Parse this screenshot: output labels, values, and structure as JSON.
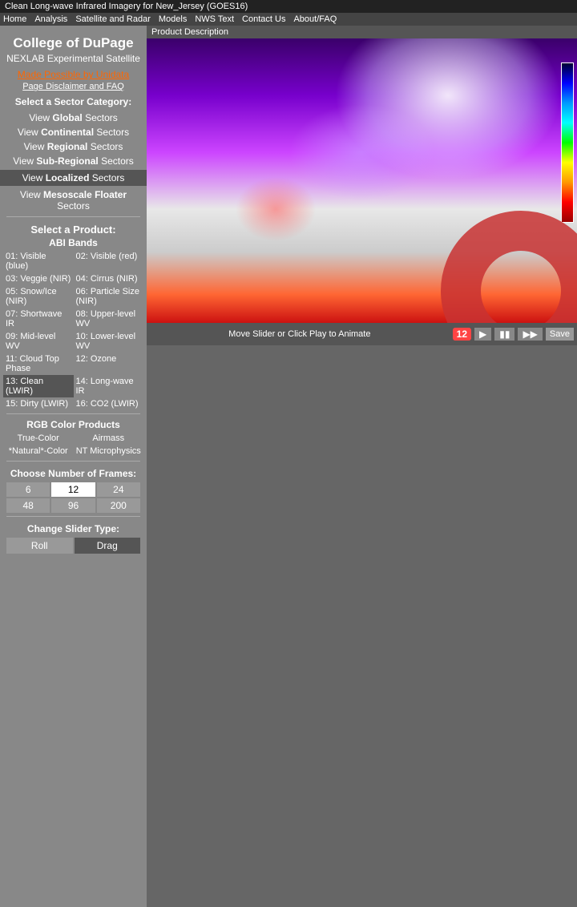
{
  "title_bar": {
    "text": "Clean Long-wave Infrared Imagery for New_Jersey (GOES16)"
  },
  "nav": {
    "items": [
      "Home",
      "Analysis",
      "Satellite and Radar",
      "Models",
      "NWS Text",
      "Contact Us",
      "About/FAQ"
    ]
  },
  "sidebar": {
    "college_name": "College of DuPage",
    "nexlab": "NEXLAB Experimental Satellite",
    "unidata_link": "Made Possible by Unidata",
    "disclaimer_link": "Page Disclaimer and FAQ",
    "sector_category_label": "Select a Sector Category:",
    "sector_links": [
      {
        "prefix": "View ",
        "bold": "Global",
        "suffix": " Sectors"
      },
      {
        "prefix": "View ",
        "bold": "Continental",
        "suffix": " Sectors"
      },
      {
        "prefix": "View ",
        "bold": "Regional",
        "suffix": " Sectors"
      },
      {
        "prefix": "View ",
        "bold": "Sub-Regional",
        "suffix": " Sectors"
      }
    ],
    "active_sector": {
      "prefix": "View ",
      "bold": "Localized",
      "suffix": " Sectors"
    },
    "mesoscale_sector": {
      "prefix": "View ",
      "bold": "Mesoscale Floater",
      "suffix": " Sectors"
    },
    "product_label": "Select a Product:",
    "abi_label": "ABI Bands",
    "bands": [
      {
        "id": "01",
        "name": "Visible (blue)",
        "active": false
      },
      {
        "id": "02",
        "name": "Visible (red)",
        "active": false
      },
      {
        "id": "03",
        "name": "Veggie (NIR)",
        "active": false
      },
      {
        "id": "04",
        "name": "Cirrus (NIR)",
        "active": false
      },
      {
        "id": "05",
        "name": "Snow/Ice (NIR)",
        "active": false
      },
      {
        "id": "06",
        "name": "Particle Size (NIR)",
        "active": false
      },
      {
        "id": "07",
        "name": "Shortwave IR",
        "active": false
      },
      {
        "id": "08",
        "name": "Upper-level WV",
        "active": false
      },
      {
        "id": "09",
        "name": "Mid-level WV",
        "active": false
      },
      {
        "id": "10",
        "name": "Lower-level WV",
        "active": false
      },
      {
        "id": "11",
        "name": "Cloud Top Phase",
        "active": false
      },
      {
        "id": "12",
        "name": "Ozone",
        "active": false
      },
      {
        "id": "13",
        "name": "Clean (LWIR)",
        "active": true
      },
      {
        "id": "14",
        "name": "Long-wave IR",
        "active": false
      },
      {
        "id": "15",
        "name": "Dirty (LWIR)",
        "active": false
      },
      {
        "id": "16",
        "name": "CO2 (LWIR)",
        "active": false
      }
    ],
    "rgb_label": "RGB Color Products",
    "rgb_products": [
      {
        "name": "True-Color"
      },
      {
        "name": "Airmass"
      },
      {
        "name": "*Natural*-Color"
      },
      {
        "name": "NT Microphysics"
      }
    ],
    "frames_label": "Choose Number of Frames:",
    "frame_options": [
      "6",
      "12",
      "24",
      "48",
      "96",
      "200"
    ],
    "active_frame": "12",
    "slider_label": "Change Slider Type:",
    "slider_options": [
      "Roll",
      "Drag"
    ],
    "active_slider": "Drag"
  },
  "product_desc": "Product Description",
  "animation_bar": {
    "label": "Move Slider or Click Play to Animate",
    "frame_count": "12",
    "save_label": "Save"
  }
}
